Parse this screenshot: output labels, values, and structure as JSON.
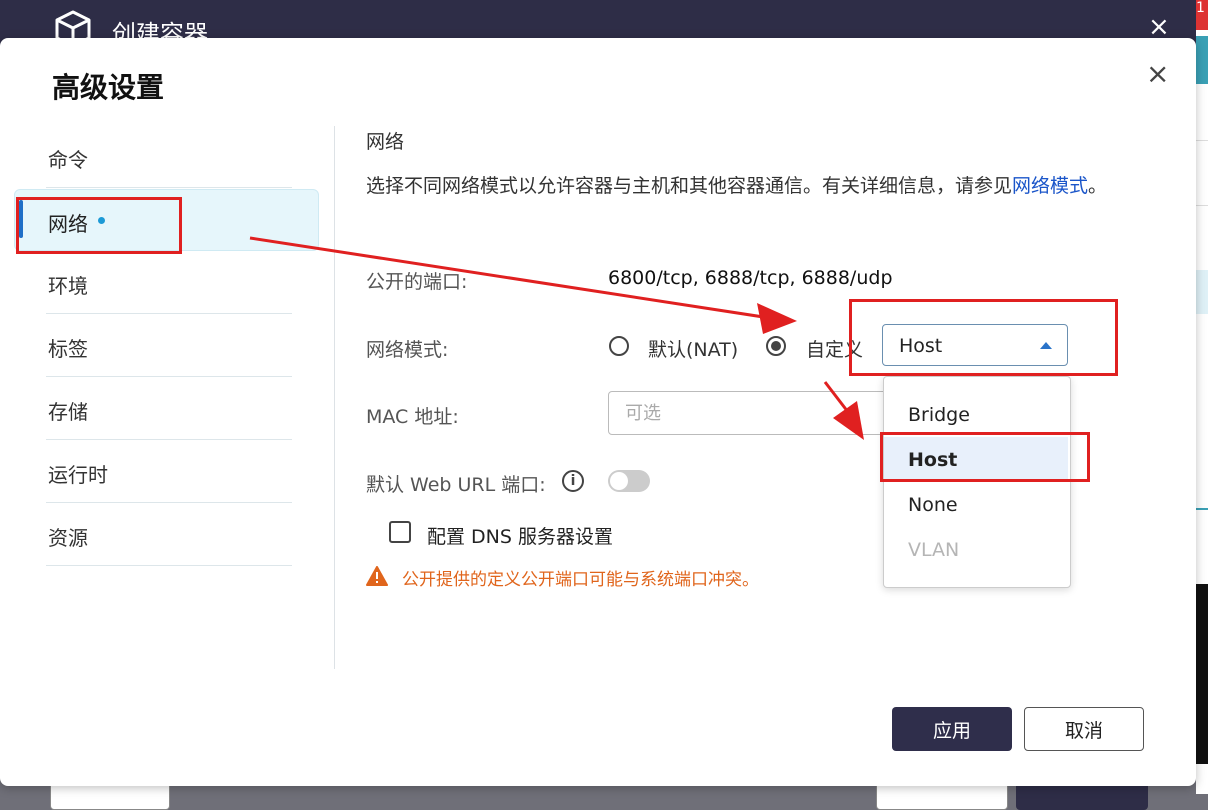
{
  "background_window": {
    "title": "创建容器",
    "close": "×",
    "side_badge": "1"
  },
  "dialog": {
    "title": "高级设置",
    "close": "×"
  },
  "sidebar": {
    "items": [
      {
        "label": "命令"
      },
      {
        "label": "网络",
        "active": true
      },
      {
        "label": "环境"
      },
      {
        "label": "标签"
      },
      {
        "label": "存储"
      },
      {
        "label": "运行时"
      },
      {
        "label": "资源"
      }
    ]
  },
  "network": {
    "section_title": "网络",
    "description": "选择不同网络模式以允许容器与主机和其他容器通信。有关详细信息，请参见",
    "description_link": "网络模式",
    "description_end": "。",
    "ports_label": "公开的端口:",
    "ports_value": "6800/tcp, 6888/tcp, 6888/udp",
    "mode_label": "网络模式:",
    "mode_options": [
      "默认(NAT)",
      "自定义"
    ],
    "mode_selected": "自定义",
    "custom_select_value": "Host",
    "mac_label": "MAC 地址:",
    "mac_placeholder": "可选",
    "web_url_label": "默认 Web URL 端口:",
    "web_url_enabled": false,
    "dns_label": "配置 DNS 服务器设置",
    "dns_checked": false,
    "warning": "公开提供的定义公开端口可能与系统端口冲突。"
  },
  "dropdown": {
    "options": [
      {
        "label": "Bridge",
        "state": "normal"
      },
      {
        "label": "Host",
        "state": "selected"
      },
      {
        "label": "None",
        "state": "normal"
      },
      {
        "label": "VLAN",
        "state": "disabled"
      }
    ]
  },
  "footer": {
    "apply_label": "应用",
    "cancel_label": "取消"
  },
  "colors": {
    "header_bg": "#2e2d47",
    "accent_blue": "#1f6fc7",
    "active_bg": "#e6f6fb",
    "warning_orange": "#e0651c",
    "annotation_red": "#e02020"
  }
}
